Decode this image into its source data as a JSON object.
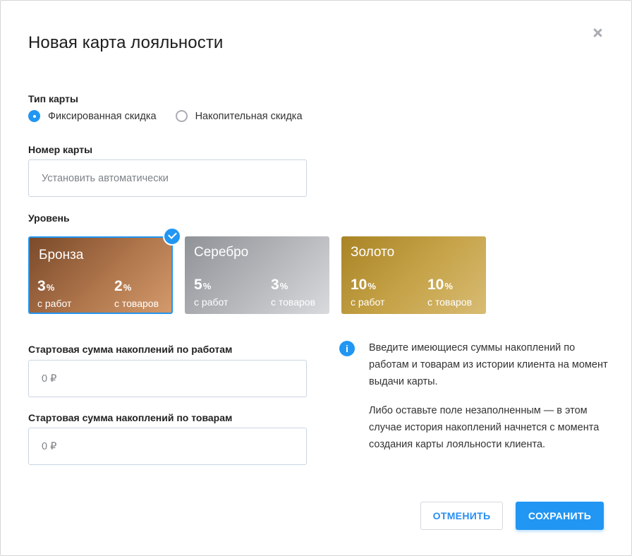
{
  "modal": {
    "title": "Новая карта лояльности",
    "close_icon": "close-icon"
  },
  "card_type": {
    "label": "Тип карты",
    "options": [
      {
        "label": "Фиксированная скидка",
        "selected": true
      },
      {
        "label": "Накопительная скидка",
        "selected": false
      }
    ]
  },
  "card_number": {
    "label": "Номер карты",
    "value": "",
    "placeholder": "Установить автоматически"
  },
  "level": {
    "label": "Уровень",
    "selected": "Бронза",
    "cards": [
      {
        "name": "Бронза",
        "works_value": "3",
        "works_unit": "%",
        "works_label": "с работ",
        "goods_value": "2",
        "goods_unit": "%",
        "goods_label": "с товаров"
      },
      {
        "name": "Серебро",
        "works_value": "5",
        "works_unit": "%",
        "works_label": "с работ",
        "goods_value": "3",
        "goods_unit": "%",
        "goods_label": "с товаров"
      },
      {
        "name": "Золото",
        "works_value": "10",
        "works_unit": "%",
        "works_label": "с работ",
        "goods_value": "10",
        "goods_unit": "%",
        "goods_label": "с товаров"
      }
    ]
  },
  "start_works": {
    "label": "Стартовая сумма накоплений по работам",
    "value": "",
    "placeholder": "0 ₽"
  },
  "start_goods": {
    "label": "Стартовая сумма накоплений по товарам",
    "value": "",
    "placeholder": "0 ₽"
  },
  "info": {
    "icon_glyph": "i",
    "paragraph1": "Введите имеющиеся суммы накоплений по работам и товарам из истории клиента на момент выдачи карты.",
    "paragraph2": "Либо оставьте поле незаполненным — в этом случае история накоплений начнется с момента создания карты лояльности клиента."
  },
  "actions": {
    "cancel_label": "ОТМЕНИТЬ",
    "save_label": "СОХРАНИТЬ"
  },
  "colors": {
    "accent": "#2196f3",
    "input_border": "#c9d6e2",
    "bronze": "#b0764c",
    "silver": "#b3b5b9",
    "gold": "#c5a247"
  }
}
